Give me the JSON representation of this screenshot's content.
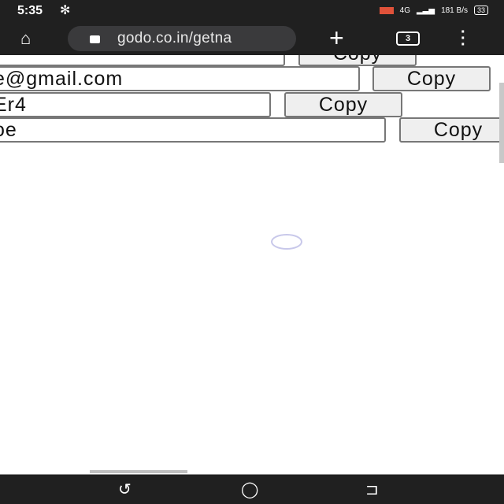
{
  "status": {
    "time": "5:35",
    "network": "4G",
    "speed": "181 B/s",
    "battery": "33"
  },
  "browser": {
    "url": "godo.co.in/getna",
    "tab_count": "3"
  },
  "rows": [
    {
      "value": "",
      "button": "Copy"
    },
    {
      "value": "e@gmail.com",
      "button": "Copy"
    },
    {
      "value": "Er4",
      "button": "Copy"
    },
    {
      "value": "oe",
      "button": "Copy"
    }
  ]
}
